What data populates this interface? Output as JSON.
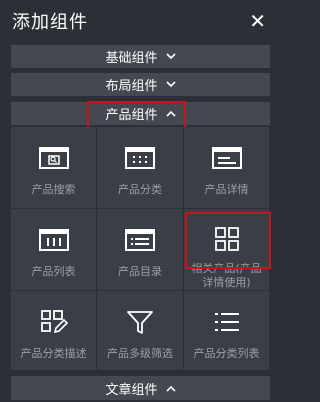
{
  "header": {
    "title": "添加组件",
    "close_icon": "close-icon"
  },
  "sections": [
    {
      "label": "基础组件",
      "state": "collapsed",
      "icon": "chevron-down-icon"
    },
    {
      "label": "布局组件",
      "state": "collapsed",
      "icon": "chevron-down-icon"
    },
    {
      "label": "产品组件",
      "state": "expanded",
      "icon": "chevron-up-icon"
    },
    {
      "label": "文章组件",
      "state": "expanded",
      "icon": "chevron-up-icon"
    }
  ],
  "widgets": [
    {
      "label": "产品搜索",
      "icon": "product-search-icon"
    },
    {
      "label": "产品分类",
      "icon": "product-category-icon"
    },
    {
      "label": "产品详情",
      "icon": "product-detail-icon"
    },
    {
      "label": "产品列表",
      "icon": "product-list-icon"
    },
    {
      "label": "产品目录",
      "icon": "product-catalog-icon"
    },
    {
      "label": "相关产品(产品详情使用)",
      "icon": "related-products-grid-icon"
    },
    {
      "label": "产品分类描述",
      "icon": "category-description-icon"
    },
    {
      "label": "产品多级筛选",
      "icon": "filter-funnel-icon"
    },
    {
      "label": "产品分类列表",
      "icon": "category-list-icon"
    }
  ],
  "colors": {
    "background": "#2c2f36",
    "section": "#444851",
    "cell": "#3a3e46",
    "highlight": "#c8151d",
    "label": "#9aa0a8"
  }
}
